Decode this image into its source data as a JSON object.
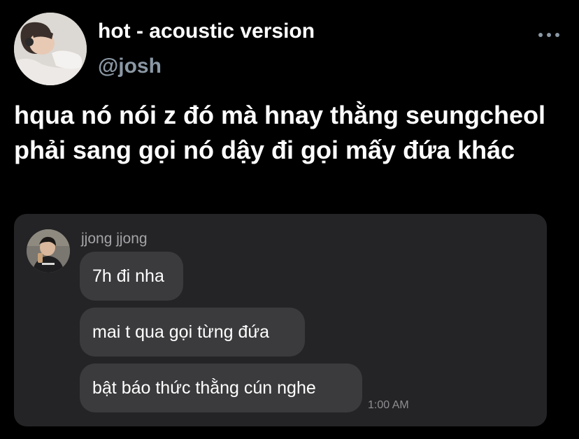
{
  "tweet": {
    "display_name": "hot - acoustic version",
    "handle": "@josh",
    "more_icon": "more-horizontal-icon",
    "text": "hqua nó nói z đó mà hnay thằng seungcheol phải sang gọi nó dậy đi gọi mấy đứa khác"
  },
  "chat": {
    "sender_name": "jjong jjong",
    "messages": [
      "7h đi nha",
      "mai t qua gọi từng đứa",
      "bật báo thức thằng cún nghe"
    ],
    "timestamp": "1:00 AM"
  },
  "colors": {
    "background": "#000000",
    "handle": "#8b98a5",
    "media_background": "#242426",
    "bubble": "#3b3b3d",
    "secondary_text": "#a4a4a8"
  }
}
